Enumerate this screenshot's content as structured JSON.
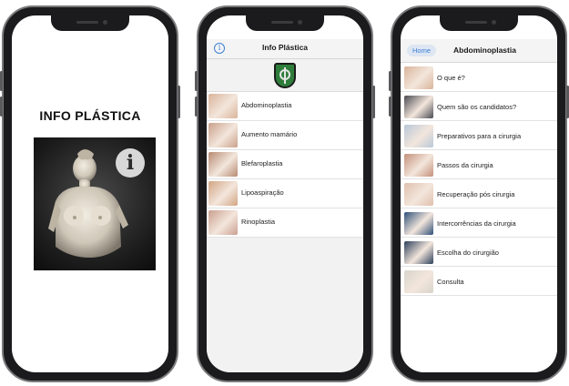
{
  "colors": {
    "accent": "#3d7fd6",
    "emblem_green": "#2f7d3b",
    "list_divider": "#e2e2e2",
    "nav_background": "#f4f4f4",
    "phone_frame": "#1b1b1d"
  },
  "splash": {
    "title": "INFO PLÁSTICA",
    "icon_name": "info-icon",
    "info_glyph": "i"
  },
  "procedures_screen": {
    "title": "Info Plástica",
    "info_glyph": "i",
    "emblem_name": "shield-emblem-icon",
    "items": [
      {
        "label": "Abdominoplastia",
        "thumb_color": "#d9b49a"
      },
      {
        "label": "Aumento mamário",
        "thumb_color": "#c9a08a"
      },
      {
        "label": "Blefaroplastia",
        "thumb_color": "#b78a72"
      },
      {
        "label": "Lipoaspiração",
        "thumb_color": "#d2a583"
      },
      {
        "label": "Rinoplastia",
        "thumb_color": "#caa08f"
      }
    ]
  },
  "detail_screen": {
    "back_label": "Home",
    "title": "Abdominoplastia",
    "items": [
      {
        "label": "O que é?",
        "thumb_color": "#d9b49a"
      },
      {
        "label": "Quem são os candidatos?",
        "thumb_color": "#4a4a52"
      },
      {
        "label": "Preparativos para a cirurgia",
        "thumb_color": "#b9c7d8"
      },
      {
        "label": "Passos da cirurgia",
        "thumb_color": "#c4907a"
      },
      {
        "label": "Recuperação pós cirurgia",
        "thumb_color": "#e0c0ae"
      },
      {
        "label": "Intercorrências da cirurgia",
        "thumb_color": "#2e4f78"
      },
      {
        "label": "Escolha do cirurgião",
        "thumb_color": "#2b3f5a"
      },
      {
        "label": "Consulta",
        "thumb_color": "#d8d4cc"
      }
    ]
  }
}
